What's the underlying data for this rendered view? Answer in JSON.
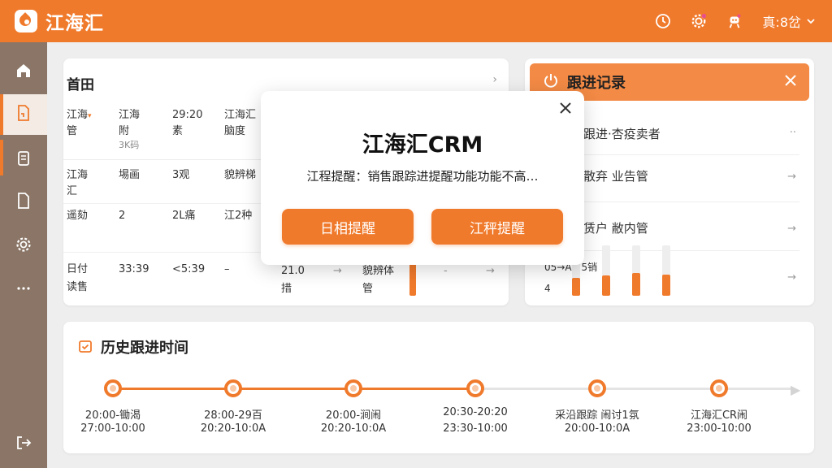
{
  "header": {
    "app_name": "江海汇",
    "user_name": "真:8岔",
    "icons": [
      "clock-icon",
      "settings-icon",
      "robot-icon",
      "chevron-down-icon"
    ]
  },
  "sidebar": {
    "icons": [
      "home-icon",
      "document-icon",
      "clipboard-icon",
      "file-icon",
      "settings-icon",
      "more-icon",
      "logout-icon"
    ]
  },
  "table": {
    "title": "首田",
    "header": {
      "c1": "江海",
      "c1b": "管",
      "c2": "江海",
      "c2b": "附",
      "c2c": "3K码",
      "c3": "29:20",
      "c3b": "素",
      "c4": "江海汇",
      "c4b": "脑度"
    },
    "rows": [
      {
        "c1": "江海",
        "c1b": "汇",
        "c2": "埸画",
        "c3": "3观",
        "c4": "貌辨梯"
      },
      {
        "c1": "遥劾",
        "c2": "2",
        "c3": "2L痛",
        "c4": "江2种"
      },
      {
        "c1": "日付",
        "c1b": "读售",
        "c2": "33:39",
        "c3": "<5:39",
        "c4": "–"
      }
    ],
    "extra": {
      "v1": "21.0",
      "v1b": "措",
      "v2": "→",
      "v3": "貌辨体",
      "v3b": "管",
      "v4": "-",
      "v5": "→"
    }
  },
  "follow": {
    "title": "跟进记录",
    "items": [
      {
        "label": "跟进·杏疫卖者",
        "arrow": "··"
      },
      {
        "label": "散弃 业告管",
        "arrow": "→"
      },
      {
        "label": "赁户 敝内管",
        "arrow": "→"
      }
    ],
    "mini": {
      "label_a": "05→AK|5销",
      "label_b": "4",
      "arrow": "→",
      "levels": [
        0.35,
        0.4,
        0.45,
        0.42
      ]
    }
  },
  "timeline": {
    "title": "历史跟进时间",
    "nodes": [
      {
        "line1": "20:00-锄渴",
        "line2": "27:00-10:00"
      },
      {
        "line1": "28:00-29百",
        "line2": "20:20-10:0A"
      },
      {
        "line1": "20:00-涧闹",
        "line2": "20:20-10:0A"
      },
      {
        "line1": "20:30-20:20",
        "line2": "23:30-10:00"
      },
      {
        "line1": "采沿跟踪 闹讨1氛",
        "line2": "20:00-10:0A"
      },
      {
        "line1": "江海汇CR闹",
        "line2": "23:00-10:00"
      }
    ]
  },
  "modal": {
    "title": "江海汇CRM",
    "message": "江程提醒：销售跟踪进提醒功能功能不高…",
    "btn_left": "日相提醒",
    "btn_right": "江秤提醒"
  },
  "colors": {
    "accent": "#f07a2c",
    "sidebar": "#8a7566"
  }
}
